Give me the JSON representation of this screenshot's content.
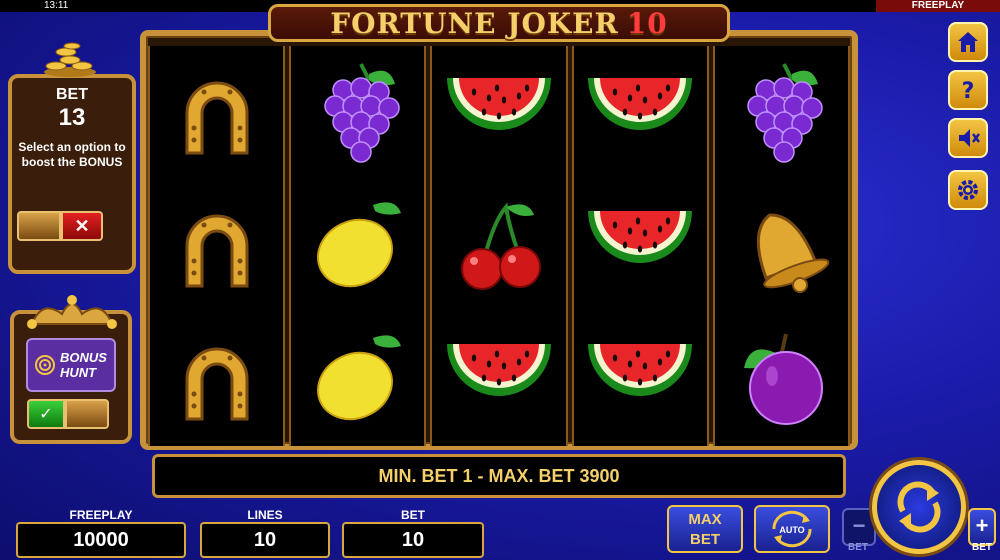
{
  "status_bar": {
    "time": "13:11",
    "mode": "FREEPLAY"
  },
  "game": {
    "title": "FORTUNE JOKER",
    "title_number": "10"
  },
  "bet_panel": {
    "label": "BET",
    "value": "13",
    "description": "Select an option to boost the BONUS",
    "reject_symbol": "✕"
  },
  "bonus_hunt": {
    "line1": "BONUS",
    "line2": "HUNT",
    "accept_symbol": "✓"
  },
  "reels": [
    [
      "horseshoe",
      "horseshoe",
      "horseshoe"
    ],
    [
      "grapes",
      "lemon",
      "lemon"
    ],
    [
      "watermelon",
      "cherries",
      "watermelon"
    ],
    [
      "watermelon",
      "watermelon",
      "watermelon"
    ],
    [
      "grapes",
      "bell",
      "plum"
    ]
  ],
  "side_icons": [
    "home-icon",
    "help-icon",
    "sound-off-icon",
    "settings-icon"
  ],
  "info_bar": {
    "text": "MIN. BET 1 - MAX. BET 3900"
  },
  "counters": {
    "freeplay": {
      "label": "FREEPLAY",
      "value": "10000"
    },
    "lines": {
      "label": "LINES",
      "value": "10"
    },
    "bet": {
      "label": "BET",
      "value": "10"
    }
  },
  "controls": {
    "max_bet_line1": "MAX",
    "max_bet_line2": "BET",
    "auto_label": "AUTO",
    "minus": "−",
    "plus": "+",
    "bet_minus_label": "BET",
    "bet_plus_label": "BET"
  },
  "colors": {
    "gold": "#d9a640",
    "background": "#1a1ba8",
    "reel_bg": "#000000"
  }
}
